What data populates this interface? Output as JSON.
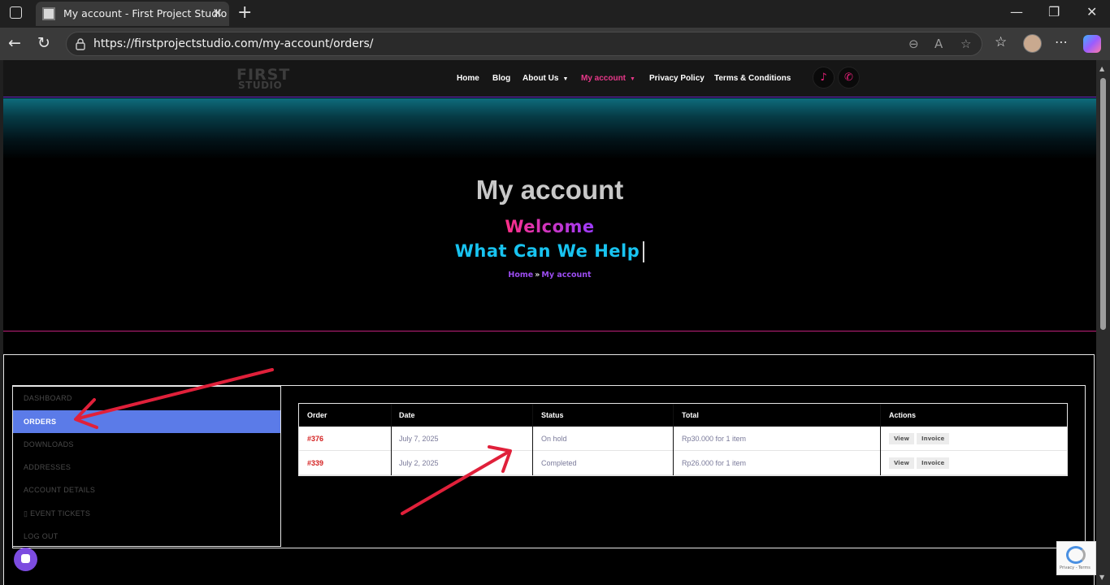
{
  "browser": {
    "tab_title": "My account - First Project Studio",
    "url": "https://firstprojectstudio.com/my-account/orders/"
  },
  "site": {
    "logo_line1": "FIRST",
    "logo_line2": "STUDIO",
    "menu": [
      "Home",
      "Blog",
      "About Us",
      "My account",
      "Privacy Policy",
      "Terms & Conditions"
    ],
    "active_menu_color": "#e8388a"
  },
  "hero": {
    "title": "My account",
    "welcome": "Welcome",
    "tagline": "What Can We Help",
    "breadcrumb_home": "Home",
    "breadcrumb_sep": "»",
    "breadcrumb_current": "My account"
  },
  "account_nav": [
    "DASHBOARD",
    "ORDERS",
    "DOWNLOADS",
    "ADDRESSES",
    "ACCOUNT DETAILS",
    "EVENT TICKETS",
    "LOG OUT"
  ],
  "account_nav_active_index": 1,
  "orders": {
    "headers": [
      "Order",
      "Date",
      "Status",
      "Total",
      "Actions"
    ],
    "rows": [
      {
        "order": "#376",
        "date": "July 7, 2025",
        "status": "On hold",
        "total": "Rp30.000 for 1 item",
        "view": "View",
        "invoice": "Invoice"
      },
      {
        "order": "#339",
        "date": "July 2, 2025",
        "status": "Completed",
        "total": "Rp26.000 for 1 item",
        "view": "View",
        "invoice": "Invoice"
      }
    ]
  },
  "recaptcha": {
    "text": "Privacy - Terms"
  },
  "colors": {
    "accent": "#5b7be8",
    "order_number": "#d42020",
    "tagline": "#18c3f0",
    "annotation_arrow": "#e0203a"
  }
}
